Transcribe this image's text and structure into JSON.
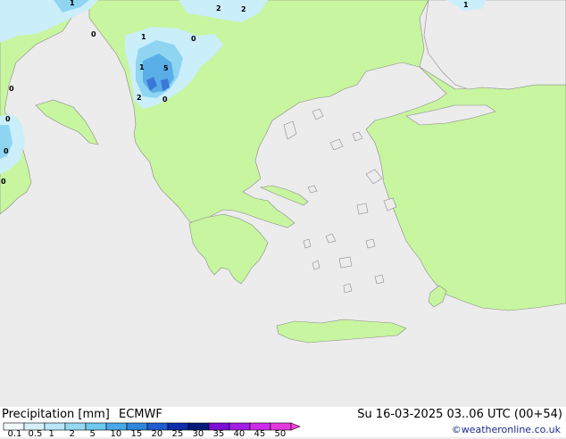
{
  "legend": {
    "title": "Precipitation [mm]",
    "model": "ECMWF",
    "valid_time": "Su 16-03-2025 03..06 UTC (00+54)",
    "credit": "©weatheronline.co.uk",
    "ticks": [
      "0.1",
      "0.5",
      "1",
      "2",
      "5",
      "10",
      "15",
      "20",
      "25",
      "30",
      "35",
      "40",
      "45",
      "50"
    ],
    "colors": [
      "#f2fbff",
      "#d6f0fb",
      "#b9e6f8",
      "#96d9f3",
      "#6fc8ee",
      "#4aa9e6",
      "#2f86dc",
      "#1f5ccd",
      "#0d2ea8",
      "#001a7a",
      "#7b0fd6",
      "#a31de3",
      "#cc2ce8",
      "#e43ae0"
    ],
    "arrow_color": "#ff3fd6"
  },
  "map_labels": [
    {
      "text": "1"
    },
    {
      "text": "2"
    },
    {
      "text": "2"
    },
    {
      "text": "1"
    },
    {
      "text": "0"
    },
    {
      "text": "1"
    },
    {
      "text": "0"
    },
    {
      "text": "1"
    },
    {
      "text": "5"
    },
    {
      "text": "2"
    },
    {
      "text": "0"
    },
    {
      "text": "0"
    },
    {
      "text": "0"
    },
    {
      "text": "0"
    },
    {
      "text": "0"
    }
  ],
  "colors": {
    "land": "#c8f5a0",
    "sea": "#ececec",
    "coast": "#8a8a8a",
    "precip_light": "#cbeefb",
    "precip_mid": "#8fd5f2",
    "precip_strong": "#5aaee8",
    "precip_heavy": "#3a78d8"
  }
}
